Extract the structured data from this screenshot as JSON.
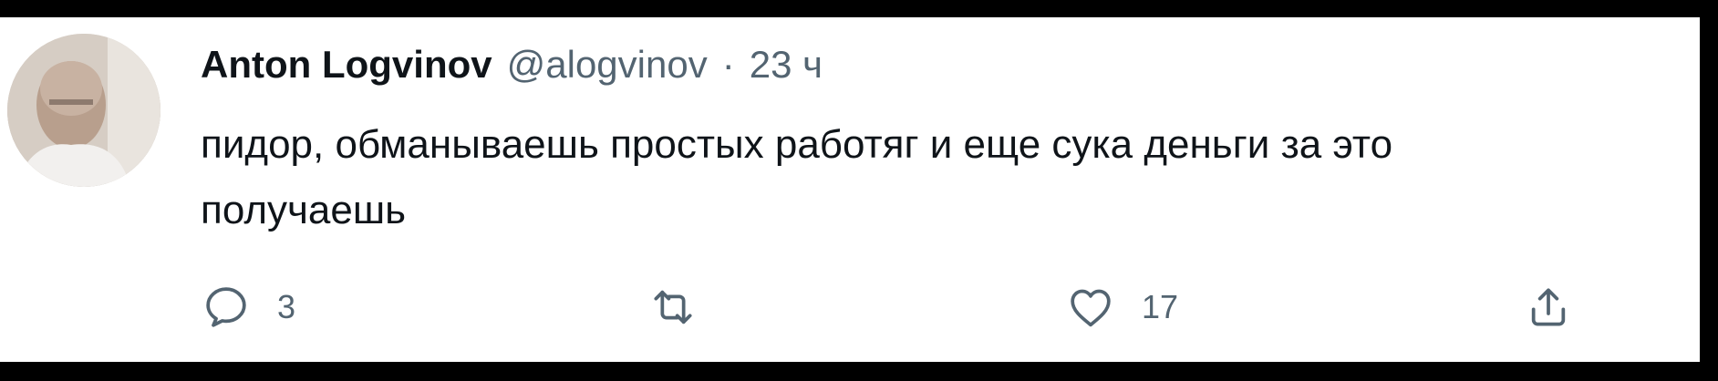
{
  "tweet": {
    "author": {
      "display_name": "Anton Logvinov",
      "handle": "@alogvinov"
    },
    "separator": "·",
    "time": "23 ч",
    "text": "пидор, обманываешь простых работяг и еще сука деньги за это\nполучаешь",
    "actions": {
      "reply": {
        "icon": "reply-icon",
        "count": "3"
      },
      "retweet": {
        "icon": "retweet-icon",
        "count": ""
      },
      "like": {
        "icon": "heart-icon",
        "count": "17"
      },
      "share": {
        "icon": "share-icon",
        "count": ""
      }
    }
  }
}
